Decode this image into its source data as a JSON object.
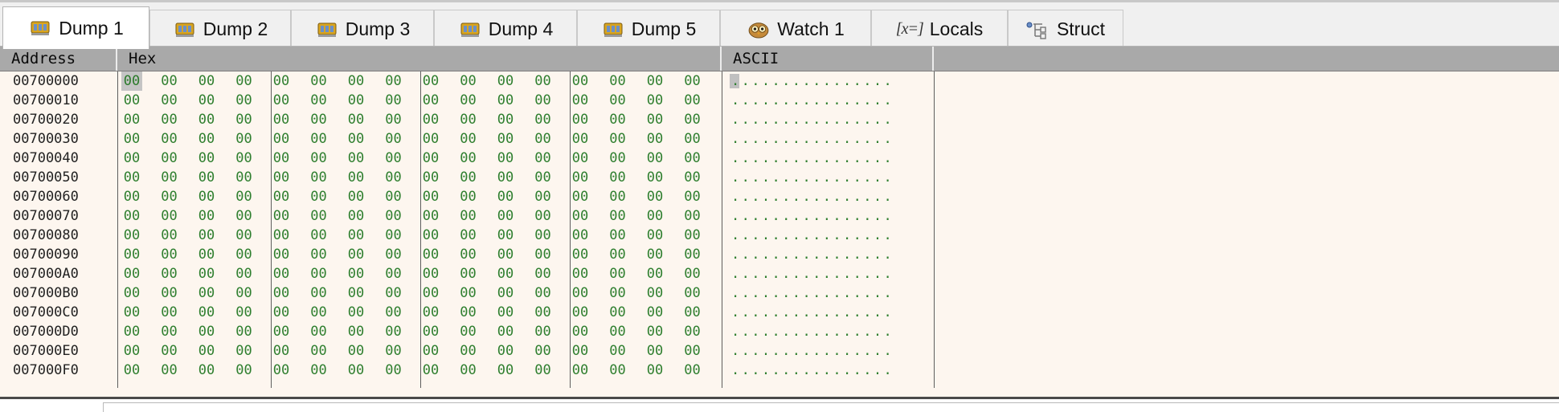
{
  "tabs": [
    {
      "label": "Dump 1",
      "icon": "memory-chip-icon",
      "active": true
    },
    {
      "label": "Dump 2",
      "icon": "memory-chip-icon",
      "active": false
    },
    {
      "label": "Dump 3",
      "icon": "memory-chip-icon",
      "active": false
    },
    {
      "label": "Dump 4",
      "icon": "memory-chip-icon",
      "active": false
    },
    {
      "label": "Dump 5",
      "icon": "memory-chip-icon",
      "active": false
    },
    {
      "label": "Watch 1",
      "icon": "owl-icon",
      "active": false
    },
    {
      "label": "Locals",
      "icon": "variable-icon",
      "icon_text": "[x=]",
      "active": false
    },
    {
      "label": "Struct",
      "icon": "struct-tree-icon",
      "active": false
    }
  ],
  "columns": {
    "address": "Address",
    "hex": "Hex",
    "ascii": "ASCII"
  },
  "rows": [
    {
      "address": "00700000",
      "bytes": [
        "00",
        "00",
        "00",
        "00",
        "00",
        "00",
        "00",
        "00",
        "00",
        "00",
        "00",
        "00",
        "00",
        "00",
        "00",
        "00"
      ],
      "ascii": "................"
    },
    {
      "address": "00700010",
      "bytes": [
        "00",
        "00",
        "00",
        "00",
        "00",
        "00",
        "00",
        "00",
        "00",
        "00",
        "00",
        "00",
        "00",
        "00",
        "00",
        "00"
      ],
      "ascii": "................"
    },
    {
      "address": "00700020",
      "bytes": [
        "00",
        "00",
        "00",
        "00",
        "00",
        "00",
        "00",
        "00",
        "00",
        "00",
        "00",
        "00",
        "00",
        "00",
        "00",
        "00"
      ],
      "ascii": "................"
    },
    {
      "address": "00700030",
      "bytes": [
        "00",
        "00",
        "00",
        "00",
        "00",
        "00",
        "00",
        "00",
        "00",
        "00",
        "00",
        "00",
        "00",
        "00",
        "00",
        "00"
      ],
      "ascii": "................"
    },
    {
      "address": "00700040",
      "bytes": [
        "00",
        "00",
        "00",
        "00",
        "00",
        "00",
        "00",
        "00",
        "00",
        "00",
        "00",
        "00",
        "00",
        "00",
        "00",
        "00"
      ],
      "ascii": "................"
    },
    {
      "address": "00700050",
      "bytes": [
        "00",
        "00",
        "00",
        "00",
        "00",
        "00",
        "00",
        "00",
        "00",
        "00",
        "00",
        "00",
        "00",
        "00",
        "00",
        "00"
      ],
      "ascii": "................"
    },
    {
      "address": "00700060",
      "bytes": [
        "00",
        "00",
        "00",
        "00",
        "00",
        "00",
        "00",
        "00",
        "00",
        "00",
        "00",
        "00",
        "00",
        "00",
        "00",
        "00"
      ],
      "ascii": "................"
    },
    {
      "address": "00700070",
      "bytes": [
        "00",
        "00",
        "00",
        "00",
        "00",
        "00",
        "00",
        "00",
        "00",
        "00",
        "00",
        "00",
        "00",
        "00",
        "00",
        "00"
      ],
      "ascii": "................"
    },
    {
      "address": "00700080",
      "bytes": [
        "00",
        "00",
        "00",
        "00",
        "00",
        "00",
        "00",
        "00",
        "00",
        "00",
        "00",
        "00",
        "00",
        "00",
        "00",
        "00"
      ],
      "ascii": "................"
    },
    {
      "address": "00700090",
      "bytes": [
        "00",
        "00",
        "00",
        "00",
        "00",
        "00",
        "00",
        "00",
        "00",
        "00",
        "00",
        "00",
        "00",
        "00",
        "00",
        "00"
      ],
      "ascii": "................"
    },
    {
      "address": "007000A0",
      "bytes": [
        "00",
        "00",
        "00",
        "00",
        "00",
        "00",
        "00",
        "00",
        "00",
        "00",
        "00",
        "00",
        "00",
        "00",
        "00",
        "00"
      ],
      "ascii": "................"
    },
    {
      "address": "007000B0",
      "bytes": [
        "00",
        "00",
        "00",
        "00",
        "00",
        "00",
        "00",
        "00",
        "00",
        "00",
        "00",
        "00",
        "00",
        "00",
        "00",
        "00"
      ],
      "ascii": "................"
    },
    {
      "address": "007000C0",
      "bytes": [
        "00",
        "00",
        "00",
        "00",
        "00",
        "00",
        "00",
        "00",
        "00",
        "00",
        "00",
        "00",
        "00",
        "00",
        "00",
        "00"
      ],
      "ascii": "................"
    },
    {
      "address": "007000D0",
      "bytes": [
        "00",
        "00",
        "00",
        "00",
        "00",
        "00",
        "00",
        "00",
        "00",
        "00",
        "00",
        "00",
        "00",
        "00",
        "00",
        "00"
      ],
      "ascii": "................"
    },
    {
      "address": "007000E0",
      "bytes": [
        "00",
        "00",
        "00",
        "00",
        "00",
        "00",
        "00",
        "00",
        "00",
        "00",
        "00",
        "00",
        "00",
        "00",
        "00",
        "00"
      ],
      "ascii": "................"
    },
    {
      "address": "007000F0",
      "bytes": [
        "00",
        "00",
        "00",
        "00",
        "00",
        "00",
        "00",
        "00",
        "00",
        "00",
        "00",
        "00",
        "00",
        "00",
        "00",
        "00"
      ],
      "ascii": "................"
    }
  ],
  "selection": {
    "row": 0,
    "byte": 0
  },
  "colors": {
    "hex_text": "#2f7f2f",
    "pane_background": "#fdf6ef",
    "header_background": "#a9a9a9",
    "selection": "#c4c4c4"
  }
}
